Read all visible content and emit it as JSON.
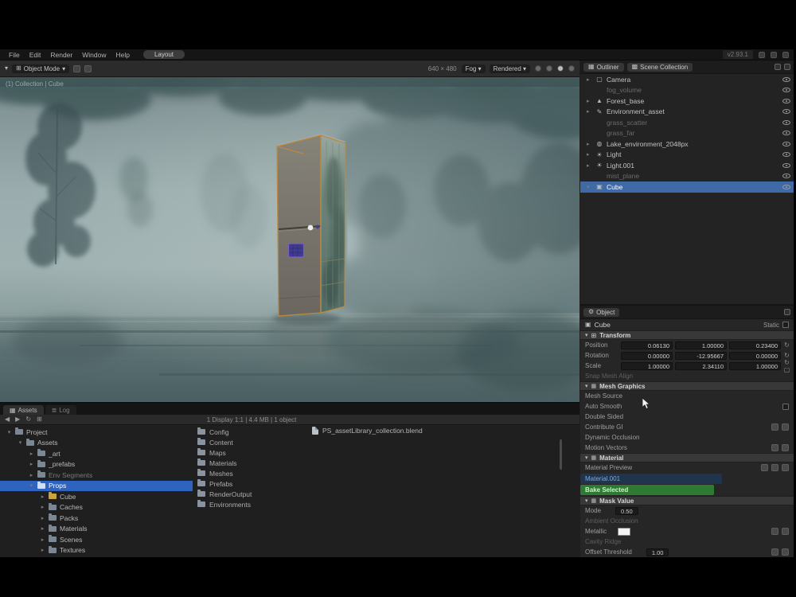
{
  "colors": {
    "accent_blue": "#3f6aa5",
    "tree_select_blue": "#2f63c0",
    "bake_green": "#2f7a33",
    "selection_orange": "#b98a43",
    "fog": "#97a9aa",
    "panel_bg": "#262626"
  },
  "topbar": {
    "menus": [
      {
        "label": "File"
      },
      {
        "label": "Edit"
      },
      {
        "label": "Render"
      },
      {
        "label": "Window"
      },
      {
        "label": "Help"
      }
    ],
    "workspace_pill": "Layout",
    "version": "v2.93.1"
  },
  "viewport": {
    "mode_chip": "Object Mode",
    "mode_caret": "▾",
    "header_right_text": "640 × 480",
    "header_chips": [
      {
        "label": "Fog ▾"
      },
      {
        "label": "Rendered ▾"
      }
    ],
    "overlay_breadcrumb": "(1) Collection | Cube"
  },
  "outliner": {
    "tab_editor": "Outliner",
    "tab_scope": "Scene Collection",
    "rows": [
      {
        "arrow": "▸",
        "icon": "▢",
        "label": "Camera",
        "cls": ""
      },
      {
        "arrow": "",
        "icon": "",
        "label": "fog_volume",
        "cls": "dim"
      },
      {
        "arrow": "▸",
        "icon": "▲",
        "label": "Forest_base",
        "cls": ""
      },
      {
        "arrow": "▸",
        "icon": "✎",
        "label": "Environment_asset",
        "cls": ""
      },
      {
        "arrow": "",
        "icon": "",
        "label": "grass_scatter",
        "cls": "dim"
      },
      {
        "arrow": "",
        "icon": "",
        "label": "grass_far",
        "cls": "dim"
      },
      {
        "arrow": "▸",
        "icon": "◍",
        "label": "Lake_environment_2048px",
        "cls": ""
      },
      {
        "arrow": "▸",
        "icon": "☀",
        "label": "Light",
        "cls": ""
      },
      {
        "arrow": "▸",
        "icon": "☀",
        "label": "Light.001",
        "cls": ""
      },
      {
        "arrow": "",
        "icon": "",
        "label": "mist_plane",
        "cls": "dim"
      },
      {
        "arrow": "▾",
        "icon": "▣",
        "label": "Cube",
        "cls": "selected"
      }
    ]
  },
  "properties": {
    "tab": "Object",
    "gear_icon": "⚙",
    "object_name": "Cube",
    "object_icon": "▣",
    "static_label": "Static",
    "transform": {
      "arrow": "▾",
      "icon": "⊞",
      "title": "Transform",
      "rows": [
        {
          "label": "Position",
          "x": "0.06130",
          "y": "1.00000",
          "z": "0.23400",
          "ic": "↻"
        },
        {
          "label": "Rotation",
          "x": "0.00000",
          "y": "-12.95667",
          "z": "0.00000",
          "ic": "↻"
        },
        {
          "label": "Scale",
          "x": "1.00000",
          "y": "2.34110",
          "z": "1.00000",
          "ic": "↻ ▢"
        }
      ]
    },
    "rows": [
      {
        "label": "Snap Mesh Align",
        "cls": "dim",
        "value": ""
      },
      {
        "label": "Mesh Graphics",
        "cls": "section",
        "value": ""
      },
      {
        "label": "Mesh Source",
        "cls": "",
        "value": ""
      },
      {
        "label": "Auto Smooth",
        "cls": "has-check",
        "value": ""
      },
      {
        "label": "Double Sided",
        "cls": "",
        "value": ""
      },
      {
        "label": "Contribute GI",
        "cls": "icons-2",
        "value": ""
      },
      {
        "label": "Dynamic Occlusion",
        "cls": "",
        "value": ""
      },
      {
        "label": "Motion Vectors",
        "cls": "icons-2",
        "value": ""
      },
      {
        "label": "Material",
        "cls": "section",
        "value": ""
      },
      {
        "label": "Material Preview",
        "cls": "icons-3",
        "value": ""
      },
      {
        "label": "Material.001",
        "cls": "link",
        "value": ""
      },
      {
        "label": "Bake Selected",
        "cls": "green",
        "value": ""
      },
      {
        "label": "Mask Value",
        "cls": "section",
        "value": ""
      },
      {
        "label": "Mode",
        "cls": "",
        "value": "0.50"
      },
      {
        "label": "Ambient Occlusion",
        "cls": "dim",
        "value": ""
      },
      {
        "label": "Metallic",
        "cls": "swatch icons-2",
        "value": ""
      },
      {
        "label": "Cavity Ridge",
        "cls": "dim",
        "value": ""
      },
      {
        "label": "Offset Threshold",
        "cls": "icons-2",
        "value": "1.00"
      }
    ]
  },
  "assets": {
    "tabs": [
      {
        "label": "Assets",
        "icon": "▦",
        "cls": ""
      },
      {
        "label": "Log",
        "icon": "≣",
        "cls": "inactive"
      }
    ],
    "nav_icons": [
      {
        "g": "◀"
      },
      {
        "g": "▶"
      },
      {
        "g": "↻"
      },
      {
        "g": "⊞"
      }
    ],
    "status": "1 Display 1:1   |   4.4 MB   |   1 object",
    "tree": [
      {
        "arrow": "▾",
        "label": "Project",
        "cls": "d0"
      },
      {
        "arrow": "▾",
        "label": "Assets",
        "cls": "d1"
      },
      {
        "arrow": "▸",
        "label": "_art",
        "cls": "d2"
      },
      {
        "arrow": "▸",
        "label": "_prefabs",
        "cls": "d2"
      },
      {
        "arrow": "▸",
        "label": "Env Segments",
        "cls": "d2 dim"
      },
      {
        "arrow": "▾",
        "label": "Props",
        "cls": "d2 selected"
      },
      {
        "arrow": "▸",
        "label": "Cube",
        "cls": "d3 gold"
      },
      {
        "arrow": "▸",
        "label": "Caches",
        "cls": "d3"
      },
      {
        "arrow": "▸",
        "label": "Packs",
        "cls": "d3"
      },
      {
        "arrow": "▸",
        "label": "Materials",
        "cls": "d3"
      },
      {
        "arrow": "▸",
        "label": "Scenes",
        "cls": "d3"
      },
      {
        "arrow": "▸",
        "label": "Textures",
        "cls": "d3"
      }
    ],
    "folders": [
      {
        "label": "Config"
      },
      {
        "label": "Content"
      },
      {
        "label": "Maps"
      },
      {
        "label": "Materials"
      },
      {
        "label": "Meshes"
      },
      {
        "label": "Prefabs"
      },
      {
        "label": "RenderOutput"
      },
      {
        "label": "Environments"
      }
    ],
    "file": "PS_assetLibrary_collection.blend"
  }
}
